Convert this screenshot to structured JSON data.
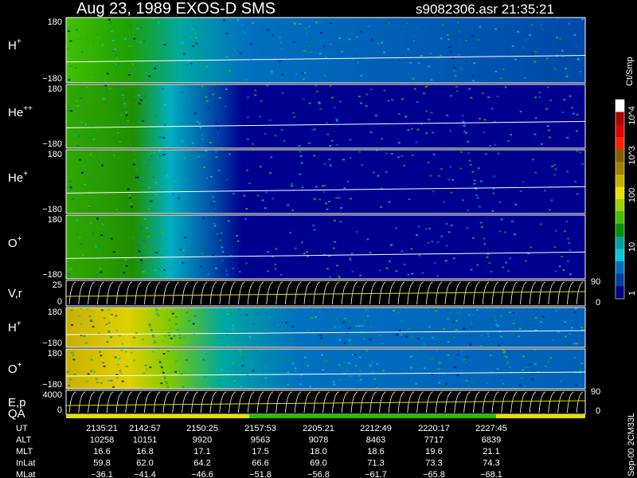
{
  "header": {
    "title": "Aug 23, 1989    EXOS-D SMS",
    "file_time": "s9082306.asr  21:35:21"
  },
  "chart_data": {
    "type": "heatmap",
    "panels": [
      {
        "label": "H",
        "sup": "+",
        "ymax": "180",
        "ymin": "−180"
      },
      {
        "label": "He",
        "sup": "++",
        "ymax": "180",
        "ymin": "−180"
      },
      {
        "label": "He",
        "sup": "+",
        "ymax": "180",
        "ymin": "−180"
      },
      {
        "label": "O",
        "sup": "+",
        "ymax": "180",
        "ymin": "−180"
      },
      {
        "label": "V,r",
        "sup": "",
        "ymax": "25",
        "ymin": "0",
        "right_top": "90",
        "right_bottom": "0"
      },
      {
        "label": "H",
        "sup": "+",
        "ymax": "180",
        "ymin": "−180"
      },
      {
        "label": "O",
        "sup": "+",
        "ymax": "180",
        "ymin": "−180"
      },
      {
        "label": "E,p",
        "sup": "",
        "ymax": "4000",
        "ymin": "0",
        "right_top": "90",
        "right_bottom": "0"
      }
    ],
    "qa_label": "QA",
    "colorbar": {
      "unit": "Ct/Smp",
      "labels": [
        "10^4",
        "10^3",
        "100",
        "10",
        "1"
      ],
      "colors": [
        "#ffffff",
        "#b00000",
        "#e00000",
        "#ff2000",
        "#806000",
        "#a08000",
        "#c8b000",
        "#e8e000",
        "#a0d000",
        "#40c000",
        "#009000",
        "#00a0a0",
        "#00c8d8",
        "#0070c0",
        "#0040a0",
        "#000080"
      ]
    },
    "footer": {
      "rows": [
        {
          "name": "UT",
          "values": [
            "2135:21",
            "2142:57",
            "2150:25",
            "2157:53",
            "2205:21",
            "2212:49",
            "2220:17",
            "2227:45"
          ]
        },
        {
          "name": "ALT",
          "values": [
            "10258",
            "10151",
            "9920",
            "9563",
            "9078",
            "8463",
            "7717",
            "6839"
          ]
        },
        {
          "name": "MLT",
          "values": [
            "16.6",
            "16.8",
            "17.1",
            "17.5",
            "18.0",
            "18.6",
            "19.6",
            "21.1"
          ]
        },
        {
          "name": "InLat",
          "values": [
            "59.8",
            "62.0",
            "64.2",
            "66.6",
            "69.0",
            "71.3",
            "73.3",
            "74.3"
          ]
        },
        {
          "name": "MLat",
          "values": [
            "−36.1",
            "−41.4",
            "−46.6",
            "−51.8",
            "−56.8",
            "−61.7",
            "−65.8",
            "−68.1"
          ]
        }
      ]
    },
    "version": "Sep-00  2CM33L"
  }
}
